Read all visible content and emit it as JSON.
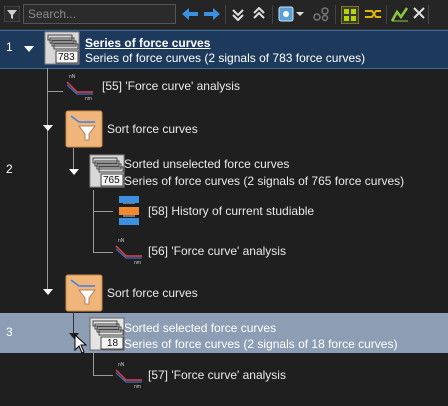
{
  "toolbar": {
    "search_placeholder": "Search...",
    "icons": [
      "filter-icon",
      "search-input",
      "arrow-left-icon",
      "arrow-right-icon",
      "collapse-all-icon",
      "expand-all-icon",
      "add-operator-icon",
      "graph-icon",
      "grid-view-icon",
      "shuffle-icon",
      "chart-icon",
      "close-icon",
      "layout-icon"
    ]
  },
  "tree": {
    "row1": {
      "number": "1",
      "title": "Series of force curves",
      "subtitle": "Series of force curves (2 signals of 783 force curves)",
      "count": "783"
    },
    "analysis_55": "[55] 'Force curve' analysis",
    "sort1": "Sort force curves",
    "row2_number": "2",
    "unselected": {
      "title": "Sorted unselected force curves",
      "subtitle": "Series of force curves (2 signals of 765 force curves)",
      "count": "765"
    },
    "history_58": "[58] History of current studiable",
    "analysis_56": "[56] 'Force curve' analysis",
    "sort2": "Sort force curves",
    "row3": {
      "number": "3",
      "title": "Sorted selected force curves",
      "subtitle": "Series of force curves (2 signals of 18 force curves)",
      "count": "18"
    },
    "analysis_57": "[57] 'Force curve' analysis"
  },
  "colors": {
    "background": "#1f1f1f",
    "selected_row": "#1d3a5c",
    "hover_row": "#8d9eb4",
    "sort_icon": "#f0b57a",
    "accent_blue": "#3d8fe0"
  }
}
